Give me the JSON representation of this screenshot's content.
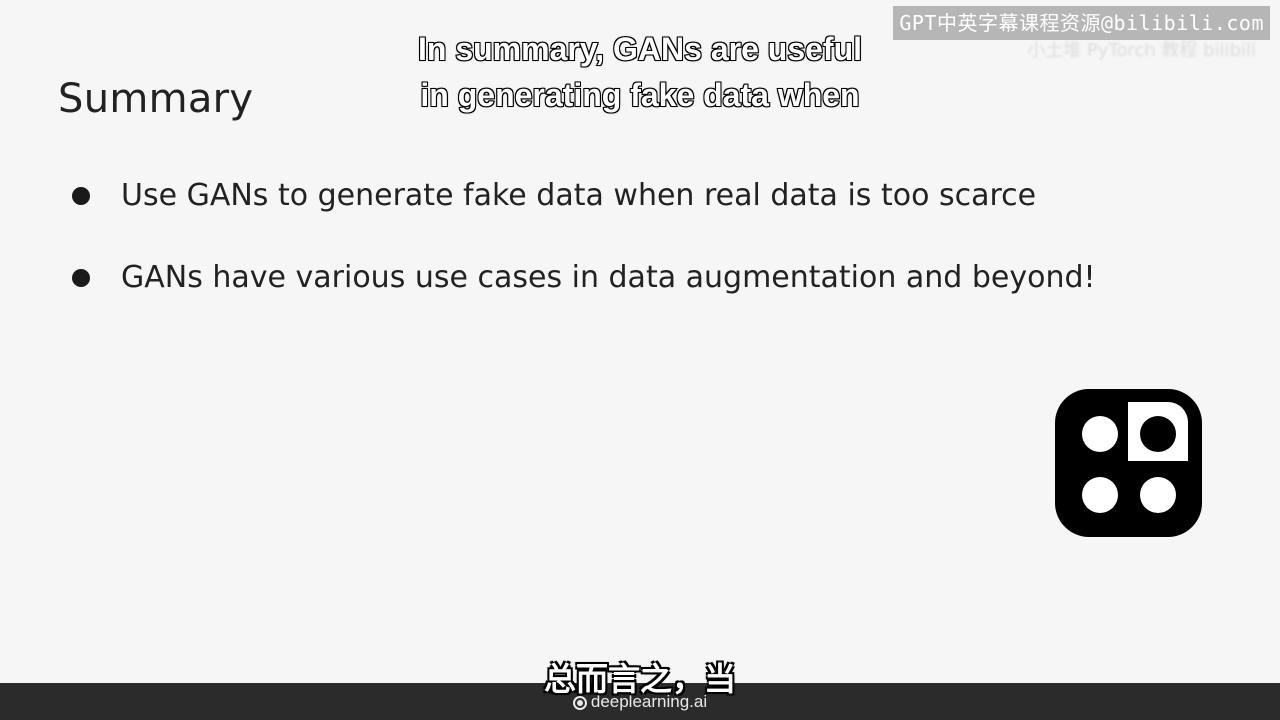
{
  "watermark": {
    "text": "GPT中英字幕课程资源@bilibili.com",
    "sub_text": "小土堆 PyTorch 教程 bilibili"
  },
  "slide": {
    "title": "Summary",
    "bullets": [
      "Use GANs to generate fake data when real data is too scarce",
      "GANs have various use cases in data augmentation and beyond!"
    ]
  },
  "captions": {
    "english_line1": "In summary, GANs are useful",
    "english_line2": "in generating fake data when",
    "chinese": "总而言之，当"
  },
  "footer": {
    "brand": "deeplearning.ai",
    "icon": "deeplearning-logo-icon"
  },
  "logo": {
    "icon": "course-logo-icon"
  }
}
